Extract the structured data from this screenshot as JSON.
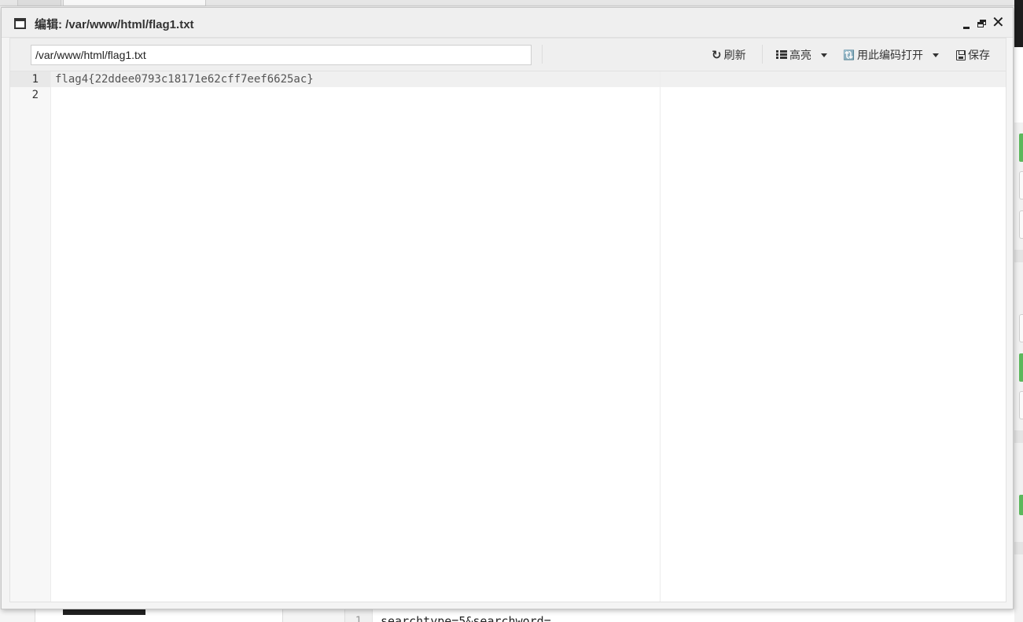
{
  "dialog": {
    "title": "编辑: /var/www/html/flag1.txt"
  },
  "toolbar": {
    "path_value": "/var/www/html/flag1.txt",
    "refresh_label": "刷新",
    "highlight_label": "高亮",
    "encoding_label": "用此编码打开",
    "save_label": "保存"
  },
  "editor": {
    "line_numbers": [
      "1",
      "2"
    ],
    "lines": [
      "flag4{22ddee0793c18171e62cff7eef6625ac}",
      ""
    ]
  },
  "background": {
    "bottom_line_number": "1",
    "bottom_code": "searchtype=5&searchword="
  }
}
